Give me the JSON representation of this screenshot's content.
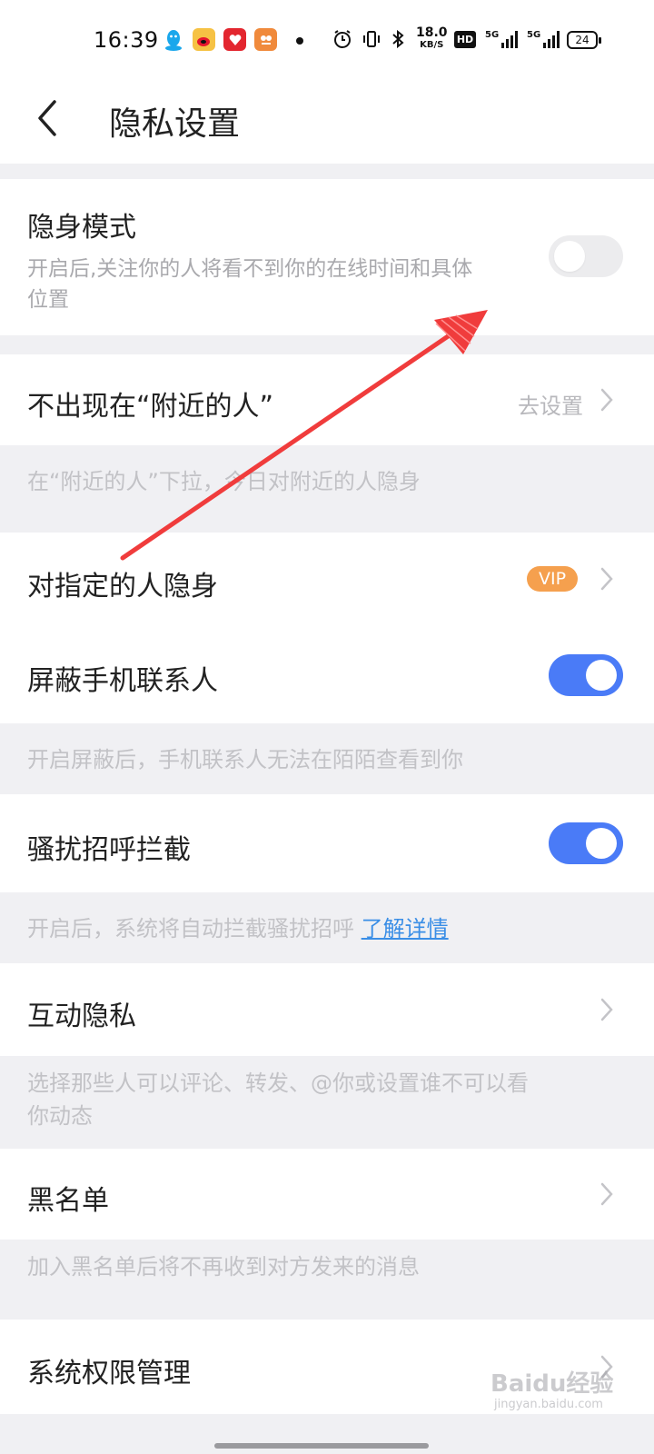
{
  "status_bar": {
    "time": "16:39",
    "net_speed_value": "18.0",
    "net_speed_unit": "KB/S",
    "hd_label": "HD",
    "battery": "24",
    "icons": [
      "qq-icon",
      "weibo-icon",
      "red-app-icon",
      "orange-app-icon",
      "alarm-icon",
      "vibrate-icon",
      "bluetooth-icon",
      "5g-signal-icon",
      "5g-signal-icon"
    ]
  },
  "header": {
    "title": "隐私设置"
  },
  "settings": {
    "stealth": {
      "title": "隐身模式",
      "subtitle_line1": "开启后,关注你的人将看不到你的在线时间和具体",
      "subtitle_line2": "位置",
      "enabled": false
    },
    "nearby": {
      "title": "不出现在“附近的人”",
      "action": "去设置",
      "hint": "在“附近的人”下拉，今日对附近的人隐身"
    },
    "specific": {
      "title": "对指定的人隐身",
      "badge": "VIP"
    },
    "contacts": {
      "title": "屏蔽手机联系人",
      "enabled": true,
      "hint": "开启屏蔽后，手机联系人无法在陌陌查看到你"
    },
    "harass": {
      "title": "骚扰招呼拦截",
      "enabled": true,
      "hint": "开启后，系统将自动拦截骚扰招呼",
      "link": "了解详情"
    },
    "interaction": {
      "title": "互动隐私",
      "hint_line1": "选择那些人可以评论、转发、@你或设置谁不可以看",
      "hint_line2": "你动态"
    },
    "blacklist": {
      "title": "黑名单",
      "hint": "加入黑名单后将不再收到对方发来的消息"
    },
    "permissions": {
      "title": "系统权限管理"
    }
  },
  "watermark": {
    "text": "Baidu经验",
    "sub": "jingyan.baidu.com"
  },
  "colors": {
    "accent_toggle": "#4a7bf7",
    "vip": "#f5a04e",
    "link": "#3a8ee6",
    "annotation_arrow": "#f03c3c"
  }
}
